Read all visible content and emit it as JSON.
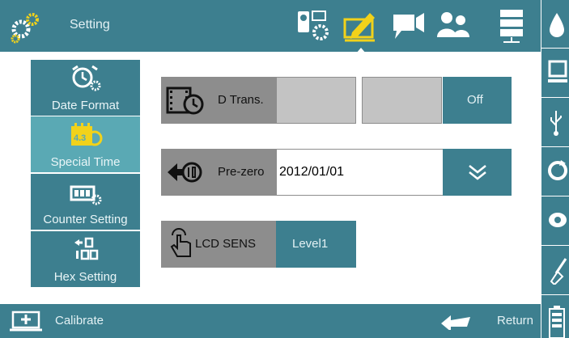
{
  "header": {
    "title": "Setting",
    "icons": [
      "camera-settings-icon",
      "edit-settings-icon",
      "camera-icon",
      "users-icon",
      "server-icon"
    ],
    "active_icon": "edit-settings-icon"
  },
  "sidebar": {
    "items": [
      {
        "label": "Date Format",
        "icon": "alarm-clock-gear-icon",
        "active": false
      },
      {
        "label": "Special Time",
        "icon": "calendar-clock-icon",
        "active": true,
        "icon_text": "4.3"
      },
      {
        "label": "Counter Setting",
        "icon": "counter-gear-icon",
        "active": false
      },
      {
        "label": "Hex Setting",
        "icon": "hex-icon",
        "active": false
      }
    ]
  },
  "main": {
    "d_trans": {
      "label": "D Trans.",
      "icon": "film-clock-icon",
      "button": "Off"
    },
    "pre_zero": {
      "label": "Pre-zero",
      "icon": "reset-icon",
      "value": "2012/01/01",
      "dropdown_icon": "double-chevron-down-icon"
    },
    "lcd_sens": {
      "label": "LCD SENS",
      "icon": "touch-hand-icon",
      "value": "Level1"
    }
  },
  "right_rail": {
    "icons": [
      "droplet-icon",
      "laptop-icon",
      "usb-icon",
      "refresh-icon",
      "eye-icon",
      "broom-icon",
      "battery-icon"
    ]
  },
  "footer": {
    "calibrate_label": "Calibrate",
    "return_label": "Return"
  },
  "colors": {
    "teal": "#3d7f8f",
    "teal_active": "#5aa9b4",
    "label_grey": "#8d8d8d",
    "field_grey": "#c3c3c3",
    "icon_yellow": "#f2d21a"
  }
}
